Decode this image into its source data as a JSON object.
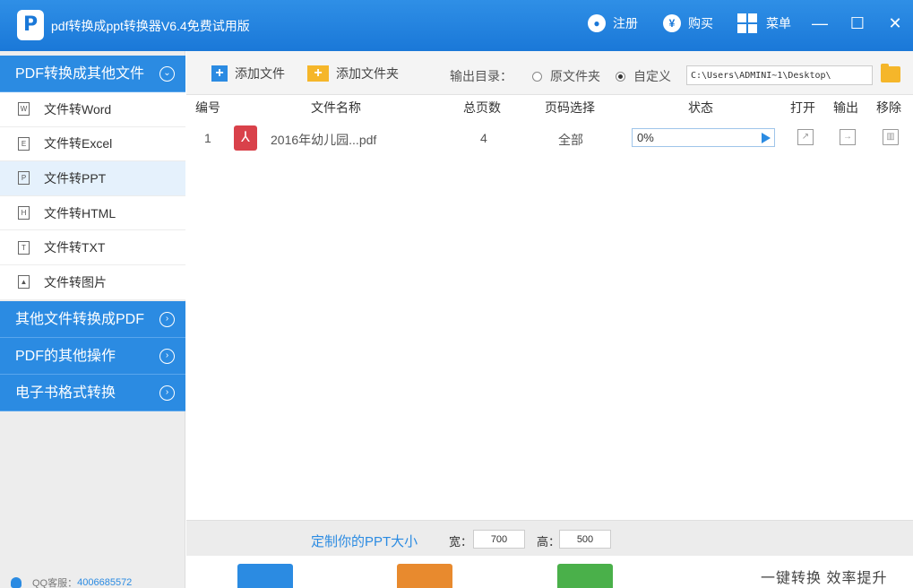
{
  "titlebar": {
    "logo": "P",
    "title": "pdf转换成ppt转换器V6.4免费试用版",
    "register": "注册",
    "buy": "购买",
    "buy_icon": "¥",
    "menu": "菜单"
  },
  "sidebar": {
    "category_active": "PDF转换成其他文件",
    "items": [
      {
        "label": "文件转Word",
        "badge": "W"
      },
      {
        "label": "文件转Excel",
        "badge": "E"
      },
      {
        "label": "文件转PPT",
        "badge": "P"
      },
      {
        "label": "文件转HTML",
        "badge": "H"
      },
      {
        "label": "文件转TXT",
        "badge": "T"
      },
      {
        "label": "文件转图片",
        "badge": "▲"
      }
    ],
    "categories": [
      "其他文件转换成PDF",
      "PDF的其他操作",
      "电子书格式转换"
    ],
    "support_label": "QQ客服：",
    "support_number": "4006685572"
  },
  "toolbar": {
    "add_file": "添加文件",
    "add_folder": "添加文件夹",
    "output_dir_label": "输出目录：",
    "radio_original": "原文件夹",
    "radio_custom": "自定义",
    "output_path": "C:\\Users\\ADMINI~1\\Desktop\\"
  },
  "table": {
    "headers": {
      "index": "编号",
      "name": "文件名称",
      "pages": "总页数",
      "page_select": "页码选择",
      "status": "状态",
      "open": "打开",
      "output": "输出",
      "remove": "移除"
    },
    "rows": [
      {
        "index": "1",
        "name": "2016年幼儿园...pdf",
        "pages": "4",
        "page_select": "全部",
        "progress": "0%",
        "progress_value": 0
      }
    ]
  },
  "bottom": {
    "custom_size_label": "定制你的PPT大小",
    "width_label": "宽：",
    "width_value": "700",
    "height_label": "高：",
    "height_value": "500",
    "slogan": "一键转换 效率提升"
  },
  "colors": {
    "primary": "#2b8be2",
    "pdf_red": "#d9414a",
    "folder_yellow": "#f5b62a"
  }
}
